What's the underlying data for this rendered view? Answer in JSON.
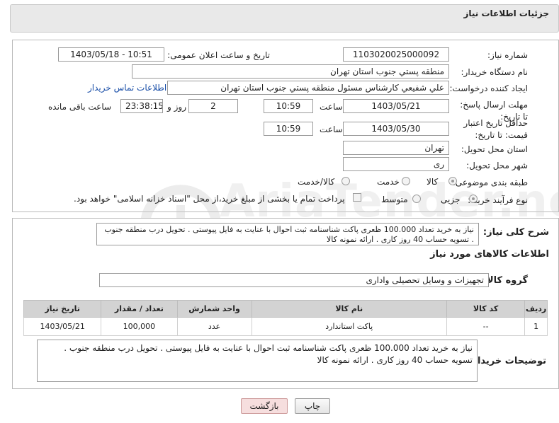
{
  "header": {
    "title": "جزئیات اطلاعات نیاز"
  },
  "form": {
    "need_number_label": "شماره نیاز:",
    "need_number": "1103020025000092",
    "announce_label": "تاریخ و ساعت اعلان عمومی:",
    "announce_value": "1403/05/18 - 10:51",
    "buyer_org_label": "نام دستگاه خریدار:",
    "buyer_org": "منطقه پستي جنوب استان تهران",
    "creator_label": "ایجاد کننده درخواست:",
    "creator": "علي شفيعي کارشناس مسئول منطقه پستي جنوب استان تهران",
    "contact_link": "اطلاعات تماس خریدار",
    "deadline_label": "مهلت ارسال پاسخ: تا تاریخ:",
    "deadline_date": "1403/05/21",
    "time_label": "ساعت",
    "deadline_time": "10:59",
    "days_value": "2",
    "days_label": "روز و",
    "remaining_time": "23:38:15",
    "remaining_label": "ساعت باقی مانده",
    "validity_label": "حداقل تاریخ اعتبار قیمت: تا تاریخ:",
    "validity_date": "1403/05/30",
    "validity_time": "10:59",
    "province_label": "استان محل تحویل:",
    "province": "تهران",
    "city_label": "شهر محل تحویل:",
    "city": "ری",
    "category_label": "طبقه بندی موضوعی:",
    "category_options": [
      "کالا",
      "خدمت",
      "کالا/خدمت"
    ],
    "process_label": "نوع فرآیند خرید :",
    "process_options": [
      "جزیی",
      "متوسط"
    ],
    "payment_note": "پرداخت تمام یا بخشی از مبلغ خرید،از محل \"اسناد خزانه اسلامی\" خواهد بود."
  },
  "general": {
    "desc_label": "شرح کلی نیاز:",
    "desc_text": "نیاز به خرید تعداد 100.000 ظعری پاکت شناسنامه ثبت احوال با عنایت به فایل پیوستی . تحویل درب منطقه جنوب . تسویه حساب 40 روز کاری . ارائه نمونه کالا",
    "goods_info_title": "اطلاعات کالاهای مورد نیاز",
    "group_label": "گروه کالا:",
    "group_value": "تجهیزات و وسایل تحصیلی واداری",
    "table": {
      "headers": [
        "ردیف",
        "کد کالا",
        "نام کالا",
        "واحد شمارش",
        "تعداد / مقدار",
        "تاریخ نیاز"
      ],
      "rows": [
        [
          "1",
          "--",
          "پاکت استاندارد",
          "عدد",
          "100,000",
          "1403/05/21"
        ]
      ]
    },
    "buyer_notes_label": "توضیحات خریدار:",
    "buyer_notes_text": "نیاز به خرید تعداد 100.000 ظعری پاکت شناسنامه ثبت احوال با عنایت به فایل پیوستی . تحویل درب منطقه جنوب . تسویه حساب 40 روز کاری . ارائه نمونه کالا"
  },
  "buttons": {
    "print": "چاپ",
    "back": "بازگشت"
  },
  "watermark": "AriaTender.neT"
}
